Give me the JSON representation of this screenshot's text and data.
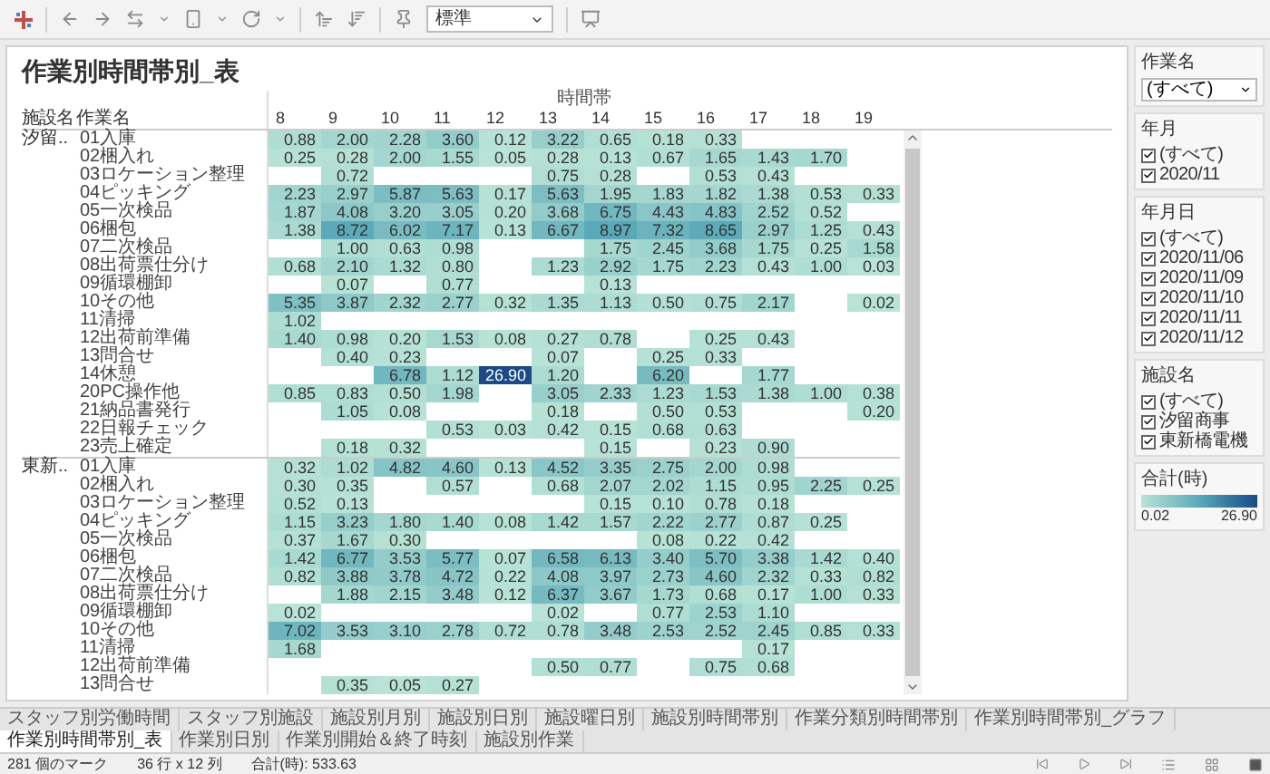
{
  "toolbar": {
    "view_select": "標準"
  },
  "sheet": {
    "title": "作業別時間帯別_表",
    "column_group": "時間帯",
    "row_headers": [
      "施設名",
      "作業名"
    ],
    "hours": [
      "8",
      "9",
      "10",
      "11",
      "12",
      "13",
      "14",
      "15",
      "16",
      "17",
      "18",
      "19"
    ],
    "groups": [
      {
        "facility": "汐留..",
        "rows": [
          {
            "task": "01入庫",
            "cells": [
              "0.88",
              "2.00",
              "2.28",
              "3.60",
              "0.12",
              "3.22",
              "0.65",
              "0.18",
              "0.33",
              null,
              null,
              null
            ]
          },
          {
            "task": "02梱入れ",
            "cells": [
              "0.25",
              "0.28",
              "2.00",
              "1.55",
              "0.05",
              "0.28",
              "0.13",
              "0.67",
              "1.65",
              "1.43",
              "1.70",
              null
            ]
          },
          {
            "task": "03ロケーション整理",
            "cells": [
              null,
              "0.72",
              null,
              null,
              null,
              "0.75",
              "0.28",
              null,
              "0.53",
              "0.43",
              null,
              null
            ]
          },
          {
            "task": "04ピッキング",
            "cells": [
              "2.23",
              "2.97",
              "5.87",
              "5.63",
              "0.17",
              "5.63",
              "1.95",
              "1.83",
              "1.82",
              "1.38",
              "0.53",
              "0.33"
            ]
          },
          {
            "task": "05一次検品",
            "cells": [
              "1.87",
              "4.08",
              "3.20",
              "3.05",
              "0.20",
              "3.68",
              "6.75",
              "4.43",
              "4.83",
              "2.52",
              "0.52",
              null
            ]
          },
          {
            "task": "06梱包",
            "cells": [
              "1.38",
              "8.72",
              "6.02",
              "7.17",
              "0.13",
              "6.67",
              "8.97",
              "7.32",
              "8.65",
              "2.97",
              "1.25",
              "0.43"
            ]
          },
          {
            "task": "07二次検品",
            "cells": [
              null,
              "1.00",
              "0.63",
              "0.98",
              null,
              null,
              "1.75",
              "2.45",
              "3.68",
              "1.75",
              "0.25",
              "1.58"
            ]
          },
          {
            "task": "08出荷票仕分け",
            "cells": [
              "0.68",
              "2.10",
              "1.32",
              "0.80",
              null,
              "1.23",
              "2.92",
              "1.75",
              "2.23",
              "0.43",
              "1.00",
              "0.03"
            ]
          },
          {
            "task": "09循環棚卸",
            "cells": [
              null,
              "0.07",
              null,
              "0.77",
              null,
              null,
              "0.13",
              null,
              null,
              null,
              null,
              null
            ]
          },
          {
            "task": "10その他",
            "cells": [
              "5.35",
              "3.87",
              "2.32",
              "2.77",
              "0.32",
              "1.35",
              "1.13",
              "0.50",
              "0.75",
              "2.17",
              null,
              "0.02"
            ]
          },
          {
            "task": "11清掃",
            "cells": [
              "1.02",
              null,
              null,
              null,
              null,
              null,
              null,
              null,
              null,
              null,
              null,
              null
            ]
          },
          {
            "task": "12出荷前準備",
            "cells": [
              "1.40",
              "0.98",
              "0.20",
              "1.53",
              "0.08",
              "0.27",
              "0.78",
              null,
              "0.25",
              "0.43",
              null,
              null
            ]
          },
          {
            "task": "13問合せ",
            "cells": [
              null,
              "0.40",
              "0.23",
              null,
              null,
              "0.07",
              null,
              "0.25",
              "0.33",
              null,
              null,
              null
            ]
          },
          {
            "task": "14休憩",
            "cells": [
              null,
              null,
              "6.78",
              "1.12",
              "26.90",
              "1.20",
              null,
              "6.20",
              null,
              "1.77",
              null,
              null
            ]
          },
          {
            "task": "20PC操作他",
            "cells": [
              "0.85",
              "0.83",
              "0.50",
              "1.98",
              null,
              "3.05",
              "2.33",
              "1.23",
              "1.53",
              "1.38",
              "1.00",
              "0.38"
            ]
          },
          {
            "task": "21納品書発行",
            "cells": [
              null,
              "1.05",
              "0.08",
              null,
              null,
              "0.18",
              null,
              "0.50",
              "0.53",
              null,
              null,
              "0.20"
            ]
          },
          {
            "task": "22日報チェック",
            "cells": [
              null,
              null,
              null,
              "0.53",
              "0.03",
              "0.42",
              "0.15",
              "0.68",
              "0.63",
              null,
              null,
              null
            ]
          },
          {
            "task": "23売上確定",
            "cells": [
              null,
              "0.18",
              "0.32",
              null,
              null,
              null,
              "0.15",
              null,
              "0.23",
              "0.90",
              null,
              null
            ]
          }
        ]
      },
      {
        "facility": "東新..",
        "rows": [
          {
            "task": "01入庫",
            "cells": [
              "0.32",
              "1.02",
              "4.82",
              "4.60",
              "0.13",
              "4.52",
              "3.35",
              "2.75",
              "2.00",
              "0.98",
              null,
              null
            ]
          },
          {
            "task": "02梱入れ",
            "cells": [
              "0.30",
              "0.35",
              null,
              "0.57",
              null,
              "0.68",
              "2.07",
              "2.02",
              "1.15",
              "0.95",
              "2.25",
              "0.25"
            ]
          },
          {
            "task": "03ロケーション整理",
            "cells": [
              "0.52",
              "0.13",
              null,
              null,
              null,
              null,
              "0.15",
              "0.10",
              "0.78",
              "0.18",
              null,
              null
            ]
          },
          {
            "task": "04ピッキング",
            "cells": [
              "1.15",
              "3.23",
              "1.80",
              "1.40",
              "0.08",
              "1.42",
              "1.57",
              "2.22",
              "2.77",
              "0.87",
              "0.25",
              null
            ]
          },
          {
            "task": "05一次検品",
            "cells": [
              "0.37",
              "1.67",
              "0.30",
              null,
              null,
              null,
              null,
              "0.08",
              "0.22",
              "0.42",
              null,
              null
            ]
          },
          {
            "task": "06梱包",
            "cells": [
              "1.42",
              "6.77",
              "3.53",
              "5.77",
              "0.07",
              "6.58",
              "6.13",
              "3.40",
              "5.70",
              "3.38",
              "1.42",
              "0.40"
            ]
          },
          {
            "task": "07二次検品",
            "cells": [
              "0.82",
              "3.88",
              "3.78",
              "4.72",
              "0.22",
              "4.08",
              "3.97",
              "2.73",
              "4.60",
              "2.32",
              "0.33",
              "0.82"
            ]
          },
          {
            "task": "08出荷票仕分け",
            "cells": [
              null,
              "1.88",
              "2.15",
              "3.48",
              "0.12",
              "6.37",
              "3.67",
              "1.73",
              "0.68",
              "0.17",
              "1.00",
              "0.33"
            ]
          },
          {
            "task": "09循環棚卸",
            "cells": [
              "0.02",
              null,
              null,
              null,
              null,
              "0.02",
              null,
              "0.77",
              "2.53",
              "1.10",
              null,
              null
            ]
          },
          {
            "task": "10その他",
            "cells": [
              "7.02",
              "3.53",
              "3.10",
              "2.78",
              "0.72",
              "0.78",
              "3.48",
              "2.53",
              "2.52",
              "2.45",
              "0.85",
              "0.33"
            ]
          },
          {
            "task": "11清掃",
            "cells": [
              "1.68",
              null,
              null,
              null,
              null,
              null,
              null,
              null,
              null,
              "0.17",
              null,
              null
            ]
          },
          {
            "task": "12出荷前準備",
            "cells": [
              null,
              null,
              null,
              null,
              null,
              "0.50",
              "0.77",
              null,
              "0.75",
              "0.68",
              null,
              null
            ]
          },
          {
            "task": "13問合せ",
            "cells": [
              null,
              "0.35",
              "0.05",
              "0.27",
              null,
              null,
              null,
              null,
              null,
              null,
              null,
              null
            ]
          }
        ]
      }
    ]
  },
  "filters": [
    {
      "kind": "dropdown",
      "title": "作業名",
      "value": "(すべて)"
    },
    {
      "kind": "checklist",
      "title": "年月",
      "items": [
        {
          "label": "(すべて)",
          "checked": true
        },
        {
          "label": "2020/11",
          "checked": true
        }
      ]
    },
    {
      "kind": "checklist",
      "title": "年月日",
      "items": [
        {
          "label": "(すべて)",
          "checked": true
        },
        {
          "label": "2020/11/06",
          "checked": true
        },
        {
          "label": "2020/11/09",
          "checked": true
        },
        {
          "label": "2020/11/10",
          "checked": true
        },
        {
          "label": "2020/11/11",
          "checked": true
        },
        {
          "label": "2020/11/12",
          "checked": true
        }
      ]
    },
    {
      "kind": "checklist",
      "title": "施設名",
      "items": [
        {
          "label": "(すべて)",
          "checked": true
        },
        {
          "label": "汐留商事",
          "checked": true
        },
        {
          "label": "東新橋電機",
          "checked": true
        }
      ]
    },
    {
      "kind": "legend",
      "title": "合計(時)",
      "min": "0.02",
      "max": "26.90"
    }
  ],
  "tabs": [
    {
      "label": "スタッフ別労働時間",
      "selected": false
    },
    {
      "label": "スタッフ別施設",
      "selected": false
    },
    {
      "label": "施設別月別",
      "selected": false
    },
    {
      "label": "施設別日別",
      "selected": false
    },
    {
      "label": "施設曜日別",
      "selected": false
    },
    {
      "label": "施設別時間帯別",
      "selected": false
    },
    {
      "label": "作業分類別時間帯別",
      "selected": false
    },
    {
      "label": "作業別時間帯別_グラフ",
      "selected": false
    },
    {
      "label": "作業別時間帯別_表",
      "selected": true
    },
    {
      "label": "作業別日別",
      "selected": false
    },
    {
      "label": "作業別開始＆終了時刻",
      "selected": false
    },
    {
      "label": "施設別作業",
      "selected": false
    }
  ],
  "status_bar": [
    "281 個のマーク",
    "36 行 x 12 列",
    "合計(時): 533.63"
  ]
}
